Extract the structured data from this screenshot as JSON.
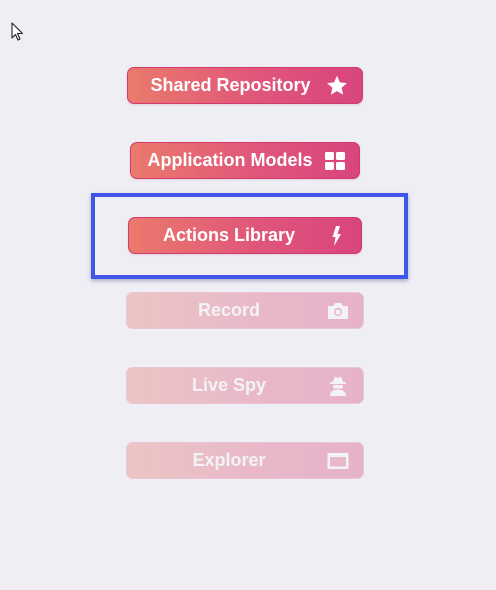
{
  "menu": {
    "items": [
      {
        "label": "Shared Repository",
        "icon": "star-icon",
        "enabled": true
      },
      {
        "label": "Application Models",
        "icon": "grid-icon",
        "enabled": true
      },
      {
        "label": "Actions Library",
        "icon": "lightning-bolt-icon",
        "enabled": true,
        "focused": true
      },
      {
        "label": "Record",
        "icon": "camera-icon",
        "enabled": false
      },
      {
        "label": "Live Spy",
        "icon": "spy-icon",
        "enabled": false
      },
      {
        "label": "Explorer",
        "icon": "window-icon",
        "enabled": false
      }
    ]
  },
  "colors": {
    "background": "#eeeef4",
    "button_gradient_start": "#ea7a6c",
    "button_gradient_end": "#d8457e",
    "focus_frame": "#4355e8"
  }
}
